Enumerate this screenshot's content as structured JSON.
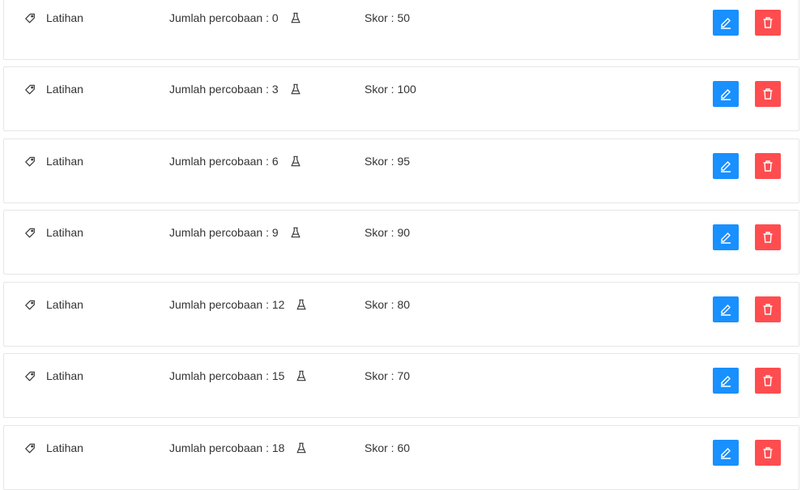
{
  "items": [
    {
      "type": "Latihan",
      "attempts": "Jumlah percobaan : 0",
      "score": "Skor : 50"
    },
    {
      "type": "Latihan",
      "attempts": "Jumlah percobaan : 3",
      "score": "Skor : 100"
    },
    {
      "type": "Latihan",
      "attempts": "Jumlah percobaan : 6",
      "score": "Skor : 95"
    },
    {
      "type": "Latihan",
      "attempts": "Jumlah percobaan : 9",
      "score": "Skor : 90"
    },
    {
      "type": "Latihan",
      "attempts": "Jumlah percobaan : 12",
      "score": "Skor : 80"
    },
    {
      "type": "Latihan",
      "attempts": "Jumlah percobaan : 15",
      "score": "Skor : 70"
    },
    {
      "type": "Latihan",
      "attempts": "Jumlah percobaan : 18",
      "score": "Skor : 60"
    }
  ],
  "icons": {
    "type": "tag-icon",
    "attempts": "flask-icon",
    "edit": "edit-icon",
    "delete": "delete-icon"
  },
  "colors": {
    "edit_button": "#1890ff",
    "delete_button": "#ff4d4f",
    "row_border": "#e6e6e6"
  }
}
